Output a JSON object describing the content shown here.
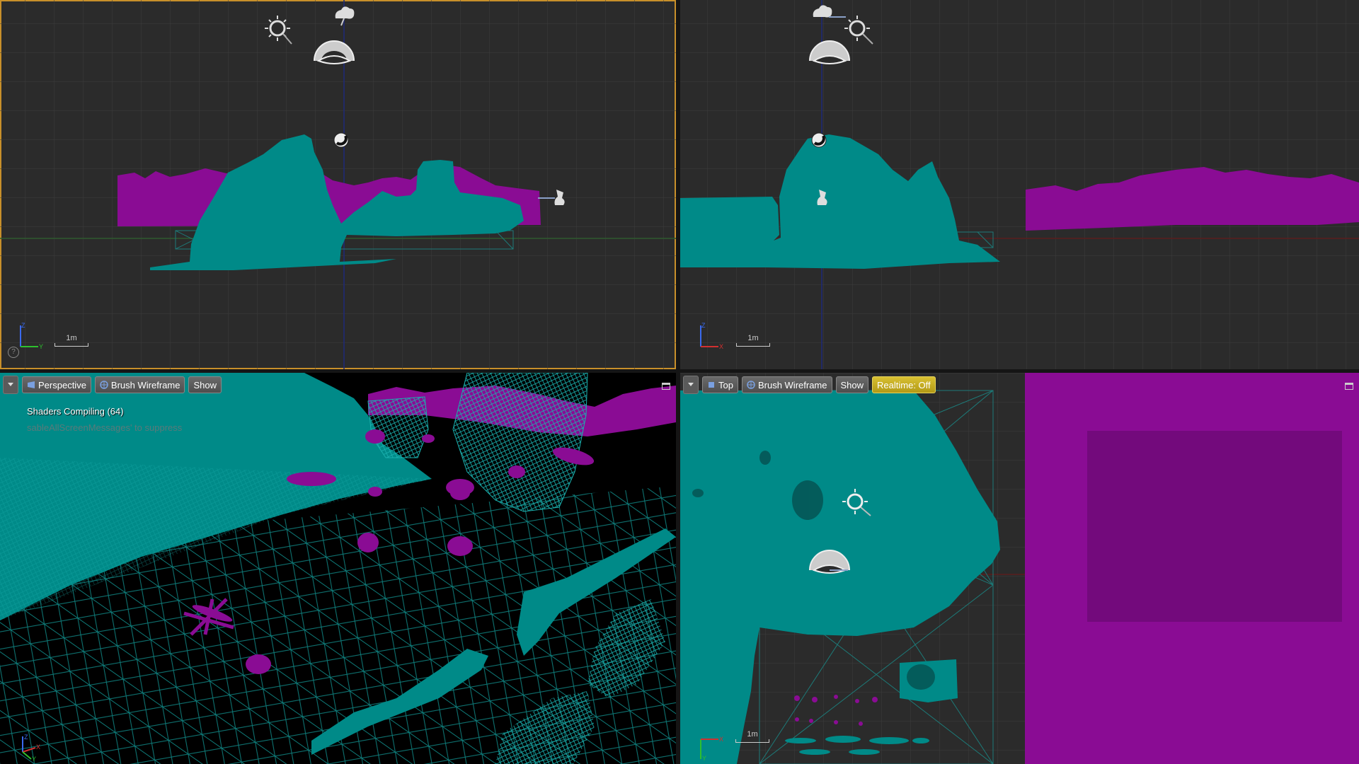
{
  "viewports": {
    "side": {
      "scale_label": "1m",
      "axis_labels": {
        "up": "Z",
        "right": "Y"
      },
      "help_glyph": "?"
    },
    "front": {
      "scale_label": "1m",
      "axis_labels": {
        "up": "Z",
        "right": "X"
      }
    },
    "perspective": {
      "menu_icon": "chevron-down-icon",
      "view_mode_label": "Perspective",
      "view_mode_icon": "perspective-icon",
      "lighting_label": "Brush Wireframe",
      "lighting_icon": "wireframe-icon",
      "show_label": "Show",
      "message": "Shaders Compiling (64)",
      "sub_message": "sableAllScreenMessages' to suppress",
      "axis_labels": {
        "x": "X",
        "y": "Y",
        "z": "Z"
      }
    },
    "top": {
      "menu_icon": "chevron-down-icon",
      "view_mode_label": "Top",
      "view_mode_icon": "top-view-icon",
      "lighting_label": "Brush Wireframe",
      "lighting_icon": "wireframe-icon",
      "show_label": "Show",
      "realtime_label": "Realtime: Off",
      "scale_label": "1m",
      "axis_labels": {
        "right": "X",
        "down": "Y"
      }
    }
  },
  "colors": {
    "teal": "#008a88",
    "magenta": "#8a0c94",
    "grid_bg": "#2b2b2b",
    "active_border": "#c8902a",
    "warning_button": "#c8ae22"
  }
}
